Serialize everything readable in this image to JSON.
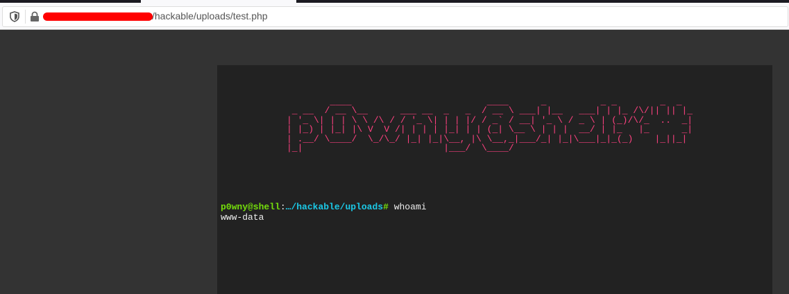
{
  "browser": {
    "url_visible": "/hackable/uploads/test.php"
  },
  "shell": {
    "banner": "        ____                         ____      _          _ _        _  _   \n _ __  / __ \\__      ___ __  _   _  / __ \\ ___| |__   ___| | |_ /\\/|| || |_ \n| '_ \\| | | \\ \\ /\\ / / '_ \\| | | |/ / _` / __| '_ \\ / _ \\ | (_)/\\/_  ..  _|\n| |_) | |_| |\\ V  V /| | | | |_| | | (_| \\__ \\ | | |  __/ | |_   |_      _|\n| .__/ \\____/  \\_/\\_/ |_| |_|\\__, |\\ \\__,_|___/_| |_|\\___|_|_(_)    |_||_|  \n|_|                          |___/  \\____/                                  ",
    "prompt_user": "p0wny@shell",
    "prompt_sep": ":",
    "prompt_cwd": "…/hackable/uploads",
    "prompt_hash": "#",
    "command": "whoami",
    "output": "www-data",
    "colors": {
      "banner": "#ff4180",
      "user": "#75df0b",
      "cwd": "#1bc9e7"
    }
  }
}
